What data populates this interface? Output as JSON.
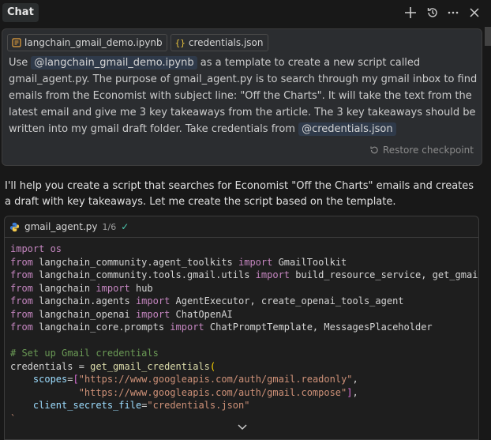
{
  "header": {
    "tab_label": "Chat",
    "icons": [
      "plus-icon",
      "history-icon",
      "more-icon",
      "close-icon"
    ]
  },
  "user_message": {
    "attachments": [
      {
        "icon": "notebook-icon",
        "label": "langchain_gmail_demo.ipynb"
      },
      {
        "icon": "json-icon",
        "label": "credentials.json"
      }
    ],
    "text_part1": "Use ",
    "mention1": "@langchain_gmail_demo.ipynb",
    "text_part2": " as a template to create a new script called gmail_agent.py. The purpose of gmail_agent.py is to search through my gmail inbox to find emails from the Economist with subject line: \"Off the Charts\". It will take the text from the latest email and give me 3 key takeaways from the article. The 3 key takeaways should be written into my gmail draft folder. Take credentials from ",
    "mention2": "@credentials.json",
    "restore_label": "Restore checkpoint"
  },
  "assistant_reply": "I'll help you create a script that searches for Economist \"Off the Charts\" emails and creates a draft with key takeaways. Let me create the script based on the template.",
  "code_block": {
    "filename": "gmail_agent.py",
    "counter": "1/6",
    "status": "✓",
    "lines": {
      "l1": "import os",
      "l2a": "from",
      "l2b": " langchain_community.agent_toolkits ",
      "l2c": "import",
      "l2d": " GmailToolkit",
      "l3a": "from",
      "l3b": " langchain_community.tools.gmail.utils ",
      "l3c": "import",
      "l3d": " build_resource_service, get_gmail_cr",
      "l4a": "from",
      "l4b": " langchain ",
      "l4c": "import",
      "l4d": " hub",
      "l5a": "from",
      "l5b": " langchain.agents ",
      "l5c": "import",
      "l5d": " AgentExecutor, create_openai_tools_agent",
      "l6a": "from",
      "l6b": " langchain_openai ",
      "l6c": "import",
      "l6d": " ChatOpenAI",
      "l7a": "from",
      "l7b": " langchain_core.prompts ",
      "l7c": "import",
      "l7d": " ChatPromptTemplate, MessagesPlaceholder",
      "comment": "# Set up Gmail credentials",
      "cred_var": "credentials = ",
      "cred_fn": "get_gmail_credentials",
      "scopes_param": "scopes",
      "scope1": "\"https://www.googleapis.com/auth/gmail.readonly\"",
      "scope2": "\"https://www.googleapis.com/auth/gmail.compose\"",
      "secrets_param": "client_secrets_file",
      "secrets_val": "\"credentials.json\"",
      "last": "`"
    }
  }
}
